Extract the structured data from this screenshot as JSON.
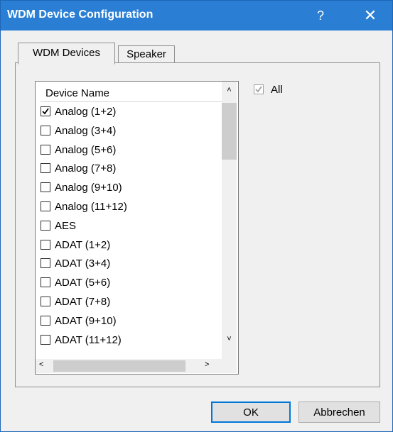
{
  "window": {
    "title": "WDM Device Configuration",
    "help": "?",
    "close": "✕"
  },
  "tabs": [
    {
      "label": "WDM Devices",
      "active": true
    },
    {
      "label": "Speaker",
      "active": false
    }
  ],
  "list": {
    "header": "Device Name",
    "items": [
      {
        "label": "Analog (1+2)",
        "checked": true
      },
      {
        "label": "Analog (3+4)",
        "checked": false
      },
      {
        "label": "Analog (5+6)",
        "checked": false
      },
      {
        "label": "Analog (7+8)",
        "checked": false
      },
      {
        "label": "Analog (9+10)",
        "checked": false
      },
      {
        "label": "Analog (11+12)",
        "checked": false
      },
      {
        "label": "AES",
        "checked": false
      },
      {
        "label": "ADAT (1+2)",
        "checked": false
      },
      {
        "label": "ADAT (3+4)",
        "checked": false
      },
      {
        "label": "ADAT (5+6)",
        "checked": false
      },
      {
        "label": "ADAT (7+8)",
        "checked": false
      },
      {
        "label": "ADAT (9+10)",
        "checked": false
      },
      {
        "label": "ADAT (11+12)",
        "checked": false
      }
    ]
  },
  "all_toggle": {
    "label": "All",
    "checked": true,
    "disabled": true
  },
  "buttons": {
    "ok": "OK",
    "cancel": "Abbrechen"
  },
  "colors": {
    "titlebar": "#2a7fd4",
    "focus_border": "#0078d7"
  }
}
